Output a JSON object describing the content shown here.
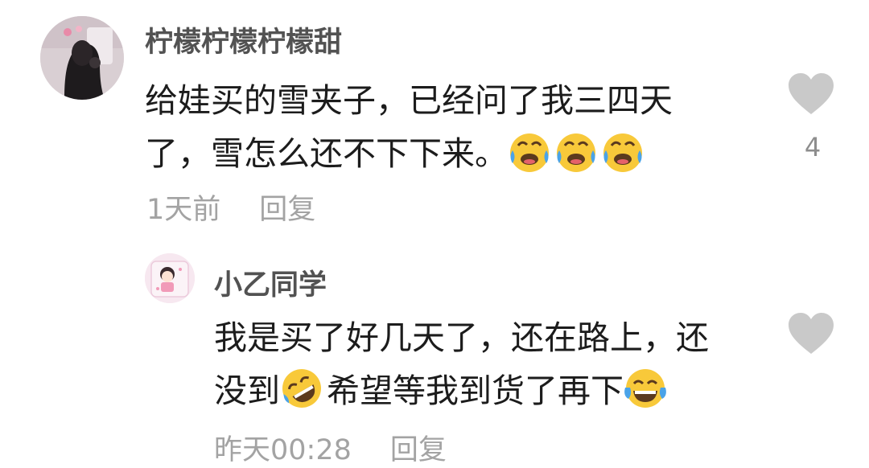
{
  "main_comment": {
    "username": "柠檬柠檬柠檬甜",
    "text_line1": "给娃买的雪夹子，已经问了我三四天",
    "text_line2": "了，雪怎么还不下下来。",
    "trailing_emojis": [
      "cry-laugh-emoji",
      "cry-laugh-emoji",
      "cry-laugh-emoji"
    ],
    "time": "1天前",
    "reply_label": "回复",
    "like_count": "4",
    "like_icon": "heart-icon"
  },
  "reply_comment": {
    "username": "小乙同学",
    "text_line1": "我是买了好几天了，还在路上，还",
    "text_line2_part1": "没到",
    "text_line2_part2": "希望等我到货了再下",
    "emoji_a": "rofl-emoji",
    "emoji_b": "tears-of-joy-emoji",
    "time": "昨天00:28",
    "reply_label": "回复",
    "like_icon": "heart-icon"
  },
  "colors": {
    "username": "#525252",
    "body_text": "#1c1c1c",
    "meta_text": "#a3a3a3",
    "heart": "#c9c9c9",
    "emoji_yellow": "#f8c93a",
    "tear_blue": "#4aa3e8"
  }
}
